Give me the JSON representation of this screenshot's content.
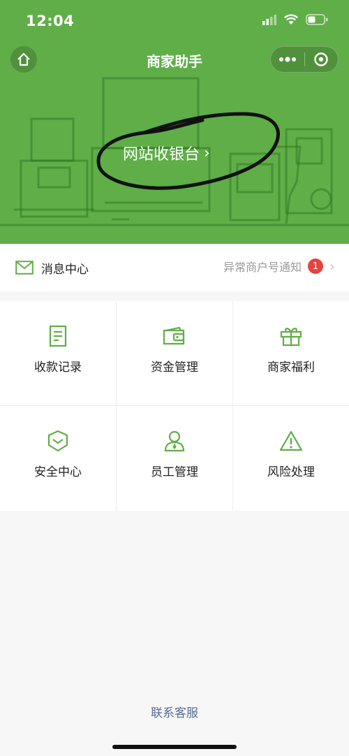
{
  "status_bar": {
    "time": "12:04",
    "icons": [
      "cellular-signal-icon",
      "wifi-icon",
      "battery-icon"
    ]
  },
  "nav": {
    "title": "商家助手",
    "home_icon": "home-icon",
    "more_icon": "more-dots-icon",
    "close_icon": "close-circle-icon"
  },
  "banner": {
    "link_text": "网站收银台",
    "arrow": "›",
    "colors": {
      "background": "#5fae47"
    }
  },
  "message_bar": {
    "title": "消息中心",
    "notice": "异常商户号通知",
    "badge_count": "1",
    "chevron": "›"
  },
  "grid": {
    "items": [
      {
        "label": "收款记录",
        "icon": "receipt-icon"
      },
      {
        "label": "资金管理",
        "icon": "wallet-icon"
      },
      {
        "label": "商家福利",
        "icon": "gift-icon"
      },
      {
        "label": "安全中心",
        "icon": "shield-icon"
      },
      {
        "label": "员工管理",
        "icon": "staff-icon"
      },
      {
        "label": "风险处理",
        "icon": "warning-icon"
      }
    ],
    "icon_color": "#5fae47"
  },
  "footer": {
    "link": "联系客服",
    "link_color": "#576b95"
  }
}
